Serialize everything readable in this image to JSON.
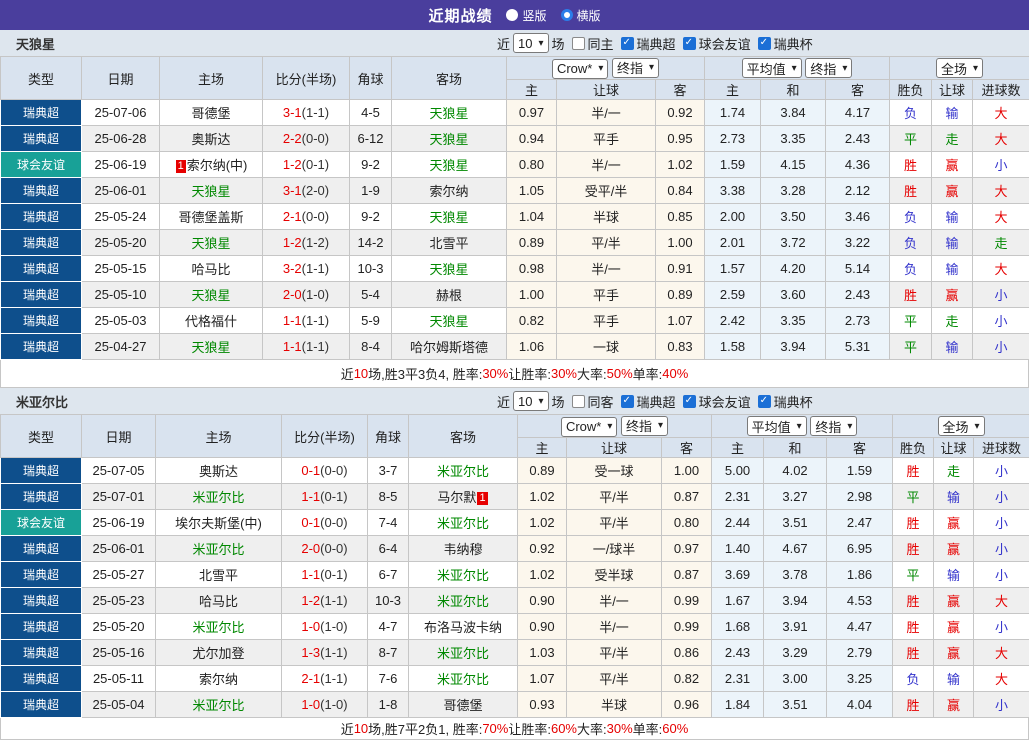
{
  "title_bar": {
    "title": "近期战绩",
    "vertical_label": "竖版",
    "horizontal_label": "横版"
  },
  "filters": {
    "near": "近",
    "matches": "场",
    "league": "瑞典超",
    "friendly": "球会友谊",
    "cup": "瑞典杯"
  },
  "columns": {
    "type": "类型",
    "date": "日期",
    "home": "主场",
    "score": "比分(半场)",
    "corner": "角球",
    "away": "客场",
    "odds_home": "主",
    "odds_handicap": "让球",
    "odds_away": "客",
    "avg_home": "主",
    "avg_draw": "和",
    "avg_away": "客",
    "result_wdl": "胜负",
    "result_handicap": "让球",
    "result_goals": "进球数"
  },
  "dropdowns": {
    "bookmaker": "Crow*",
    "final": "终指",
    "average": "平均值",
    "final2": "终指",
    "fullmatch": "全场"
  },
  "sections": [
    {
      "team": "天狼星",
      "filter": {
        "count": "10",
        "same": "同主"
      },
      "rows": [
        {
          "type": "瑞典超",
          "tk": "league",
          "date": "25-07-06",
          "home": "哥德堡",
          "hg": false,
          "score": "3-1",
          "half": "(1-1)",
          "corner": "4-5",
          "away": "天狼星",
          "ag": true,
          "odds": [
            "0.97",
            "半/一",
            "0.92"
          ],
          "avg": [
            "1.74",
            "3.84",
            "4.17"
          ],
          "res": [
            "负",
            "输",
            "大"
          ]
        },
        {
          "type": "瑞典超",
          "tk": "league",
          "date": "25-06-28",
          "home": "奥斯达",
          "hg": false,
          "score": "2-2",
          "half": "(0-0)",
          "corner": "6-12",
          "away": "天狼星",
          "ag": true,
          "odds": [
            "0.94",
            "平手",
            "0.95"
          ],
          "avg": [
            "2.73",
            "3.35",
            "2.43"
          ],
          "res": [
            "平",
            "走",
            "大"
          ]
        },
        {
          "type": "球会友谊",
          "tk": "friendly",
          "date": "25-06-19",
          "home": "索尔纳(中)",
          "hg": false,
          "hb": {
            "t": "1",
            "pos": "before"
          },
          "score": "1-2",
          "half": "(0-1)",
          "corner": "9-2",
          "away": "天狼星",
          "ag": true,
          "odds": [
            "0.80",
            "半/一",
            "1.02"
          ],
          "avg": [
            "1.59",
            "4.15",
            "4.36"
          ],
          "res": [
            "胜",
            "赢",
            "小"
          ]
        },
        {
          "type": "瑞典超",
          "tk": "league",
          "date": "25-06-01",
          "home": "天狼星",
          "hg": true,
          "score": "3-1",
          "half": "(2-0)",
          "corner": "1-9",
          "away": "索尔纳",
          "ag": false,
          "odds": [
            "1.05",
            "受平/半",
            "0.84"
          ],
          "avg": [
            "3.38",
            "3.28",
            "2.12"
          ],
          "res": [
            "胜",
            "赢",
            "大"
          ]
        },
        {
          "type": "瑞典超",
          "tk": "league",
          "date": "25-05-24",
          "home": "哥德堡盖斯",
          "hg": false,
          "score": "2-1",
          "half": "(0-0)",
          "corner": "9-2",
          "away": "天狼星",
          "ag": true,
          "odds": [
            "1.04",
            "半球",
            "0.85"
          ],
          "avg": [
            "2.00",
            "3.50",
            "3.46"
          ],
          "res": [
            "负",
            "输",
            "大"
          ]
        },
        {
          "type": "瑞典超",
          "tk": "league",
          "date": "25-05-20",
          "home": "天狼星",
          "hg": true,
          "score": "1-2",
          "half": "(1-2)",
          "corner": "14-2",
          "away": "北雪平",
          "ag": false,
          "odds": [
            "0.89",
            "平/半",
            "1.00"
          ],
          "avg": [
            "2.01",
            "3.72",
            "3.22"
          ],
          "res": [
            "负",
            "输",
            "走"
          ]
        },
        {
          "type": "瑞典超",
          "tk": "league",
          "date": "25-05-15",
          "home": "哈马比",
          "hg": false,
          "score": "3-2",
          "half": "(1-1)",
          "corner": "10-3",
          "away": "天狼星",
          "ag": true,
          "odds": [
            "0.98",
            "半/一",
            "0.91"
          ],
          "avg": [
            "1.57",
            "4.20",
            "5.14"
          ],
          "res": [
            "负",
            "输",
            "大"
          ]
        },
        {
          "type": "瑞典超",
          "tk": "league",
          "date": "25-05-10",
          "home": "天狼星",
          "hg": true,
          "score": "2-0",
          "half": "(1-0)",
          "corner": "5-4",
          "away": "赫根",
          "ag": false,
          "odds": [
            "1.00",
            "平手",
            "0.89"
          ],
          "avg": [
            "2.59",
            "3.60",
            "2.43"
          ],
          "res": [
            "胜",
            "赢",
            "小"
          ]
        },
        {
          "type": "瑞典超",
          "tk": "league",
          "date": "25-05-03",
          "home": "代格福什",
          "hg": false,
          "score": "1-1",
          "half": "(1-1)",
          "corner": "5-9",
          "away": "天狼星",
          "ag": true,
          "odds": [
            "0.82",
            "平手",
            "1.07"
          ],
          "avg": [
            "2.42",
            "3.35",
            "2.73"
          ],
          "res": [
            "平",
            "走",
            "小"
          ]
        },
        {
          "type": "瑞典超",
          "tk": "league",
          "date": "25-04-27",
          "home": "天狼星",
          "hg": true,
          "score": "1-1",
          "half": "(1-1)",
          "corner": "8-4",
          "away": "哈尔姆斯塔德",
          "ag": false,
          "odds": [
            "1.06",
            "一球",
            "0.83"
          ],
          "avg": [
            "1.58",
            "3.94",
            "5.31"
          ],
          "res": [
            "平",
            "输",
            "小"
          ]
        }
      ],
      "summary": [
        {
          "t": "近"
        },
        {
          "t": "10",
          "r": true
        },
        {
          "t": "场,胜3平3负4, 胜率:"
        },
        {
          "t": "30%",
          "r": true
        },
        {
          "t": " 让胜率:"
        },
        {
          "t": "30%",
          "r": true
        },
        {
          "t": " 大率:"
        },
        {
          "t": "50%",
          "r": true
        },
        {
          "t": " 单率:"
        },
        {
          "t": "40%",
          "r": true
        }
      ]
    },
    {
      "team": "米亚尔比",
      "filter": {
        "count": "10",
        "same": "同客"
      },
      "rows": [
        {
          "type": "瑞典超",
          "tk": "league",
          "date": "25-07-05",
          "home": "奥斯达",
          "hg": false,
          "score": "0-1",
          "half": "(0-0)",
          "corner": "3-7",
          "away": "米亚尔比",
          "ag": true,
          "odds": [
            "0.89",
            "受一球",
            "1.00"
          ],
          "avg": [
            "5.00",
            "4.02",
            "1.59"
          ],
          "res": [
            "胜",
            "走",
            "小"
          ]
        },
        {
          "type": "瑞典超",
          "tk": "league",
          "date": "25-07-01",
          "home": "米亚尔比",
          "hg": true,
          "score": "1-1",
          "half": "(0-1)",
          "corner": "8-5",
          "away": "马尔默",
          "ag": false,
          "ab": {
            "t": "1",
            "pos": "after"
          },
          "odds": [
            "1.02",
            "平/半",
            "0.87"
          ],
          "avg": [
            "2.31",
            "3.27",
            "2.98"
          ],
          "res": [
            "平",
            "输",
            "小"
          ]
        },
        {
          "type": "球会友谊",
          "tk": "friendly",
          "date": "25-06-19",
          "home": "埃尔夫斯堡(中)",
          "hg": false,
          "score": "0-1",
          "half": "(0-0)",
          "corner": "7-4",
          "away": "米亚尔比",
          "ag": true,
          "odds": [
            "1.02",
            "平/半",
            "0.80"
          ],
          "avg": [
            "2.44",
            "3.51",
            "2.47"
          ],
          "res": [
            "胜",
            "赢",
            "小"
          ]
        },
        {
          "type": "瑞典超",
          "tk": "league",
          "date": "25-06-01",
          "home": "米亚尔比",
          "hg": true,
          "score": "2-0",
          "half": "(0-0)",
          "corner": "6-4",
          "away": "韦纳穆",
          "ag": false,
          "odds": [
            "0.92",
            "一/球半",
            "0.97"
          ],
          "avg": [
            "1.40",
            "4.67",
            "6.95"
          ],
          "res": [
            "胜",
            "赢",
            "小"
          ]
        },
        {
          "type": "瑞典超",
          "tk": "league",
          "date": "25-05-27",
          "home": "北雪平",
          "hg": false,
          "score": "1-1",
          "half": "(0-1)",
          "corner": "6-7",
          "away": "米亚尔比",
          "ag": true,
          "odds": [
            "1.02",
            "受半球",
            "0.87"
          ],
          "avg": [
            "3.69",
            "3.78",
            "1.86"
          ],
          "res": [
            "平",
            "输",
            "小"
          ]
        },
        {
          "type": "瑞典超",
          "tk": "league",
          "date": "25-05-23",
          "home": "哈马比",
          "hg": false,
          "score": "1-2",
          "half": "(1-1)",
          "corner": "10-3",
          "away": "米亚尔比",
          "ag": true,
          "odds": [
            "0.90",
            "半/一",
            "0.99"
          ],
          "avg": [
            "1.67",
            "3.94",
            "4.53"
          ],
          "res": [
            "胜",
            "赢",
            "大"
          ]
        },
        {
          "type": "瑞典超",
          "tk": "league",
          "date": "25-05-20",
          "home": "米亚尔比",
          "hg": true,
          "score": "1-0",
          "half": "(1-0)",
          "corner": "4-7",
          "away": "布洛马波卡纳",
          "ag": false,
          "odds": [
            "0.90",
            "半/一",
            "0.99"
          ],
          "avg": [
            "1.68",
            "3.91",
            "4.47"
          ],
          "res": [
            "胜",
            "赢",
            "小"
          ]
        },
        {
          "type": "瑞典超",
          "tk": "league",
          "date": "25-05-16",
          "home": "尤尔加登",
          "hg": false,
          "score": "1-3",
          "half": "(1-1)",
          "corner": "8-7",
          "away": "米亚尔比",
          "ag": true,
          "odds": [
            "1.03",
            "平/半",
            "0.86"
          ],
          "avg": [
            "2.43",
            "3.29",
            "2.79"
          ],
          "res": [
            "胜",
            "赢",
            "大"
          ]
        },
        {
          "type": "瑞典超",
          "tk": "league",
          "date": "25-05-11",
          "home": "索尔纳",
          "hg": false,
          "score": "2-1",
          "half": "(1-1)",
          "corner": "7-6",
          "away": "米亚尔比",
          "ag": true,
          "odds": [
            "1.07",
            "平/半",
            "0.82"
          ],
          "avg": [
            "2.31",
            "3.00",
            "3.25"
          ],
          "res": [
            "负",
            "输",
            "大"
          ]
        },
        {
          "type": "瑞典超",
          "tk": "league",
          "date": "25-05-04",
          "home": "米亚尔比",
          "hg": true,
          "score": "1-0",
          "half": "(1-0)",
          "corner": "1-8",
          "away": "哥德堡",
          "ag": false,
          "odds": [
            "0.93",
            "半球",
            "0.96"
          ],
          "avg": [
            "1.84",
            "3.51",
            "4.04"
          ],
          "res": [
            "胜",
            "赢",
            "小"
          ]
        }
      ],
      "summary": [
        {
          "t": "近"
        },
        {
          "t": "10",
          "r": true
        },
        {
          "t": "场,胜7平2负1, 胜率:"
        },
        {
          "t": "70%",
          "r": true
        },
        {
          "t": " 让胜率:"
        },
        {
          "t": "60%",
          "r": true
        },
        {
          "t": " 大率:"
        },
        {
          "t": "30%",
          "r": true
        },
        {
          "t": " 单率:"
        },
        {
          "t": "60%",
          "r": true
        }
      ]
    }
  ]
}
